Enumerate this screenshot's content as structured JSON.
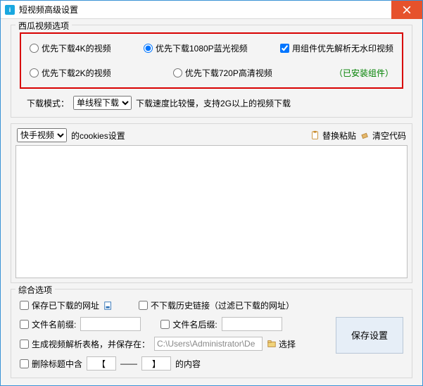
{
  "window": {
    "title": "短视频高级设置"
  },
  "xigua": {
    "group_title": "西瓜视频选项",
    "opt4k": "优先下载4K的视频",
    "opt1080": "优先下载1080P蓝光视频",
    "optPlugin": "用组件优先解析无水印视频",
    "opt2k": "优先下载2K的视频",
    "opt720": "优先下载720P高清视频",
    "installed": "（已安装组件）"
  },
  "mode": {
    "label": "下载模式：",
    "options": [
      "单线程下载"
    ],
    "selected": "单线程下载",
    "hint": "下载速度比较慢，支持2G以上的视频下载"
  },
  "cookies": {
    "sources": [
      "快手视频"
    ],
    "selected": "快手视频",
    "label": "的cookies设置",
    "paste": "替换粘贴",
    "clear": "清空代码",
    "value": ""
  },
  "misc": {
    "group_title": "综合选项",
    "saveUrls": "保存已下载的网址",
    "skipHistory": "不下载历史链接（过滤已下载的网址）",
    "prefixLabel": "文件名前缀:",
    "prefixValue": "",
    "suffixLabel": "文件名后缀:",
    "suffixValue": "",
    "tableLabel": "生成视频解析表格，并保存在：",
    "tablePath": "C:\\Users\\Administrator\\De",
    "browse": "选择",
    "stripLabel1": "删除标题中含",
    "bracket1": "【",
    "dashdash": "——",
    "bracket2": "】",
    "stripLabel2": "的内容",
    "save": "保存设置"
  }
}
